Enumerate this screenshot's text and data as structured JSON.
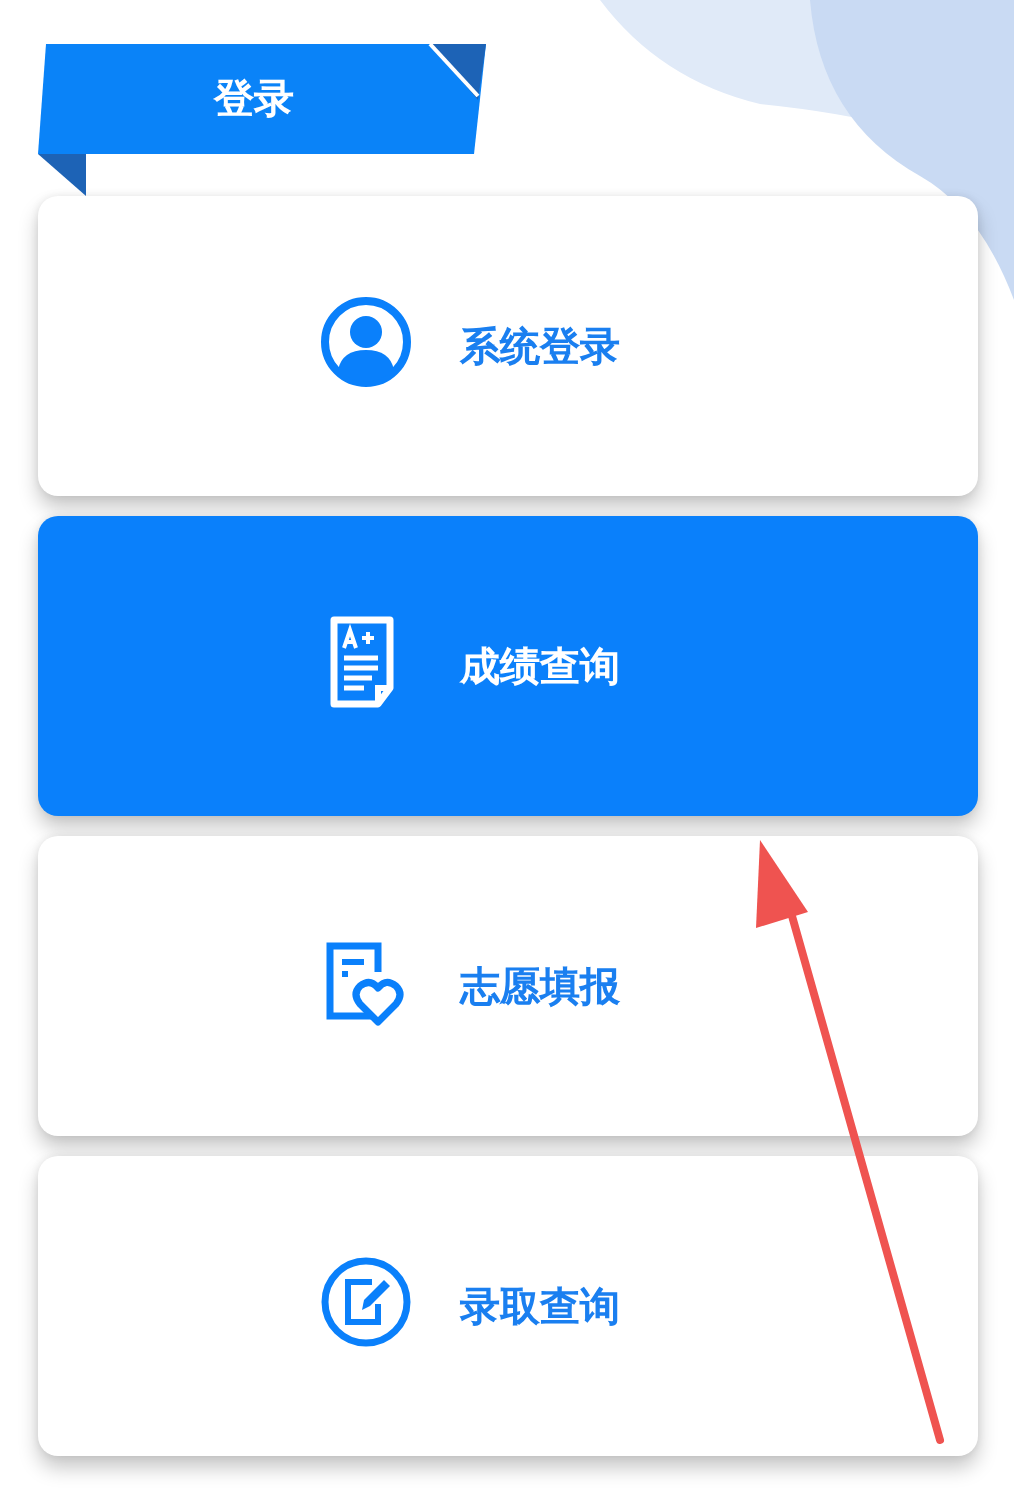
{
  "header": {
    "title": "登录"
  },
  "menu": [
    {
      "kind": "user",
      "label": "系统登录",
      "selected": false
    },
    {
      "kind": "grade",
      "label": "成绩查询",
      "selected": true
    },
    {
      "kind": "wish",
      "label": "志愿填报",
      "selected": false
    },
    {
      "kind": "admission",
      "label": "录取查询",
      "selected": false
    }
  ]
}
